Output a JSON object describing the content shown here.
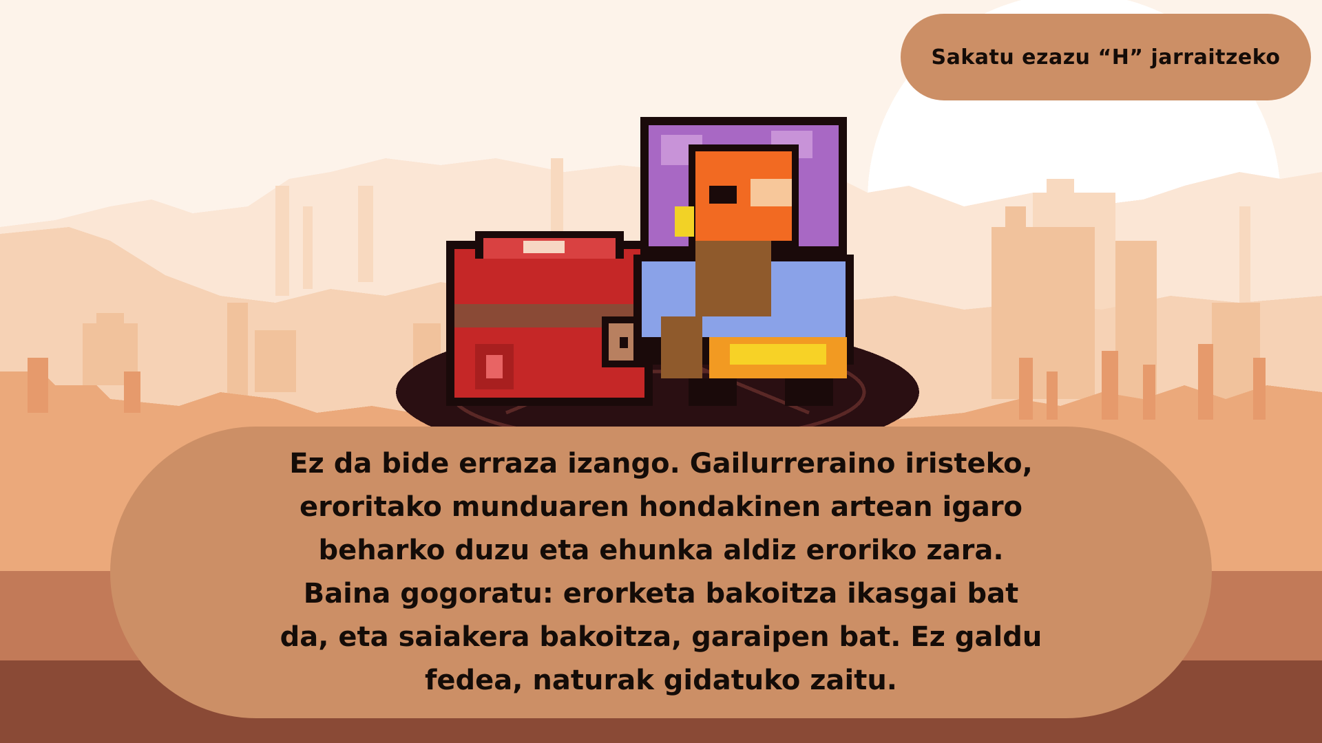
{
  "game": {
    "hint": "Sakatu ezazu “H” jarraitzeko",
    "dialog": "Ez da bide erraza izango. Gailurreraino iristeko, eroritako munduaren hondakinen artean igaro beharko duzu eta ehunka aldiz eroriko zara. Baina gogoratu: erorketa bakoitza ikasgai bat da, eta saiakera bakoitza, garaipen bat. Ez galdu fedea, naturak gidatuko zaitu.",
    "colors": {
      "sky": "#fdf3ea",
      "sun": "#ffffff",
      "panel": "#cc8f66",
      "text": "#140c08",
      "ground_dark": "#8a4a36",
      "platform": "#2a0f12"
    },
    "icons": [
      "merchant-character",
      "treasure-chest",
      "summoning-circle"
    ]
  }
}
